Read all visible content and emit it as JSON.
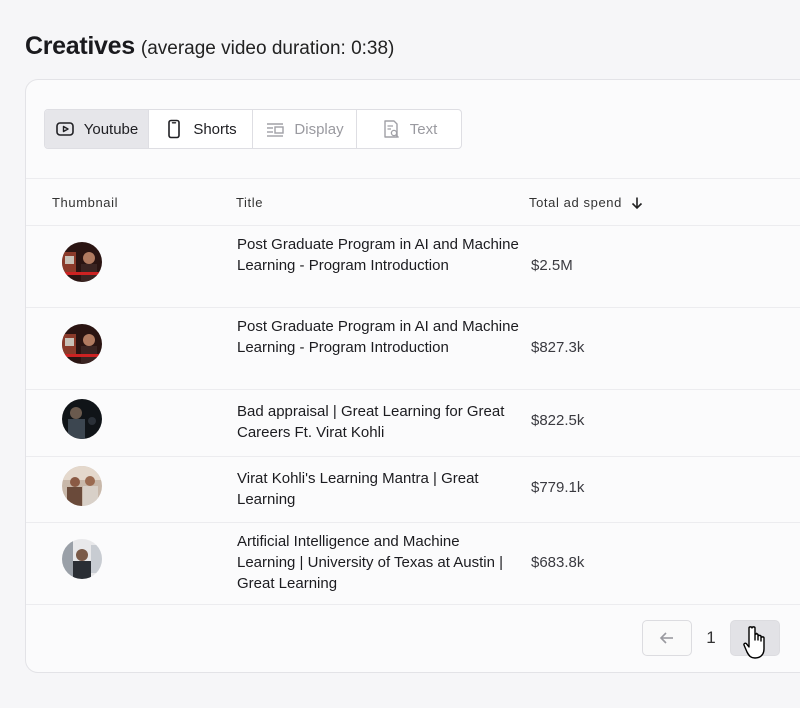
{
  "header": {
    "title": "Creatives",
    "subtitle": "(average video duration: 0:38)"
  },
  "tabs": [
    {
      "label": "Youtube",
      "icon": "youtube-icon",
      "state": "active"
    },
    {
      "label": "Shorts",
      "icon": "phone-icon",
      "state": "enabled"
    },
    {
      "label": "Display",
      "icon": "display-icon",
      "state": "muted"
    },
    {
      "label": "Text",
      "icon": "text-search-icon",
      "state": "muted"
    }
  ],
  "table": {
    "columns": [
      "Thumbnail",
      "Title",
      "Total ad spend"
    ],
    "sort_icon": "arrow-down-icon",
    "rows": [
      {
        "title": "Post Graduate Program in AI and Machine Learning - Program Introduction",
        "spend": "$2.5M"
      },
      {
        "title": "Post Graduate Program in AI and Machine Learning - Program Introduction",
        "spend": "$827.3k"
      },
      {
        "title": "Bad appraisal | Great Learning for Great Careers Ft. Virat Kohli",
        "spend": "$822.5k"
      },
      {
        "title": "Virat Kohli's Learning Mantra | Great Learning",
        "spend": "$779.1k"
      },
      {
        "title": "Artificial Intelligence and Machine Learning | University of Texas at Austin | Great Learning",
        "spend": "$683.8k"
      }
    ]
  },
  "pagination": {
    "current_page": "1",
    "prev_icon": "arrow-left-icon",
    "next_icon": "arrow-right-icon"
  },
  "colors": {
    "background": "#f6f6f8",
    "card": "#fbfbfc",
    "active_tab": "#e6e6ea",
    "muted_text": "#9a9aa0"
  }
}
